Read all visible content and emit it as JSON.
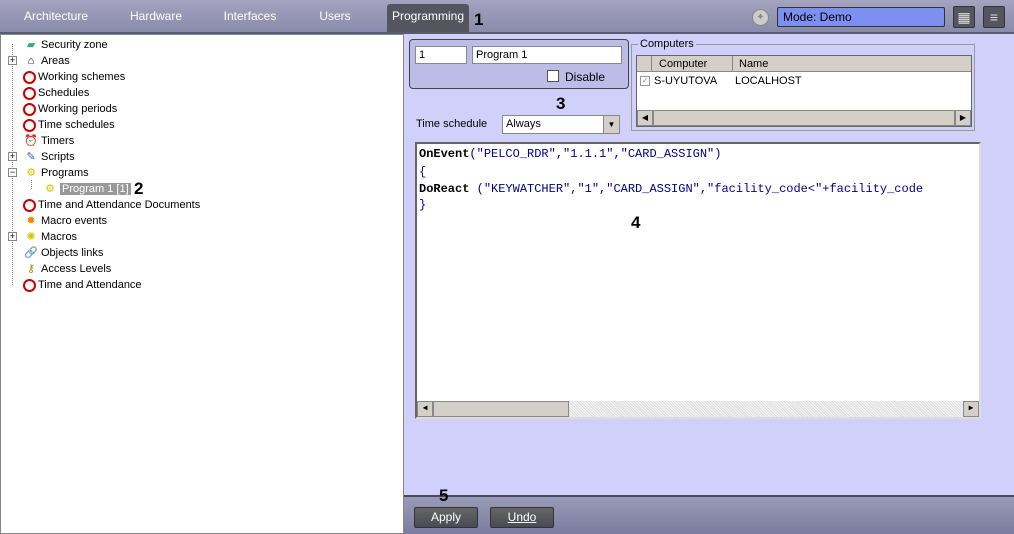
{
  "tabs": [
    "Architecture",
    "Hardware",
    "Interfaces",
    "Users",
    "Programming"
  ],
  "mode": "Mode: Demo",
  "annotations": [
    "1",
    "2",
    "3",
    "4",
    "5"
  ],
  "tree": [
    {
      "label": "Security zone",
      "icon": "security-zone-icon"
    },
    {
      "label": "Areas",
      "icon": "home-icon",
      "expander": "+"
    },
    {
      "label": "Working schemes",
      "icon": "clock-icon"
    },
    {
      "label": "Schedules",
      "icon": "clock-icon"
    },
    {
      "label": "Working periods",
      "icon": "clock-icon"
    },
    {
      "label": "Time schedules",
      "icon": "clock-icon"
    },
    {
      "label": "Timers",
      "icon": "alarm-clock-icon"
    },
    {
      "label": "Scripts",
      "icon": "script-icon",
      "expander": "+"
    },
    {
      "label": "Programs",
      "icon": "gears-icon",
      "expander": "−"
    },
    {
      "label": "Program 1 [1]",
      "icon": "gears-icon",
      "child": true,
      "selected": true
    },
    {
      "label": "Time and Attendance Documents",
      "icon": "clock-icon"
    },
    {
      "label": "Macro events",
      "icon": "macro-event-icon"
    },
    {
      "label": "Macros",
      "icon": "gear-icon",
      "expander": "+"
    },
    {
      "label": "Objects links",
      "icon": "link-icon"
    },
    {
      "label": "Access Levels",
      "icon": "keys-icon"
    },
    {
      "label": "Time and Attendance",
      "icon": "clock-icon"
    }
  ],
  "program": {
    "id": "1",
    "name": "Program 1",
    "disable_label": "Disable",
    "time_schedule_label": "Time schedule",
    "time_schedule_value": "Always"
  },
  "computers": {
    "legend": "Computers",
    "headers": [
      "Computer",
      "Name"
    ],
    "rows": [
      {
        "computer": "S-UYUTOVA",
        "name": "LOCALHOST",
        "checked": true
      }
    ]
  },
  "code": {
    "l1a": "OnEvent",
    "l1b": "(\"PELCO_RDR\",\"1.1.1\",\"CARD_ASSIGN\")",
    "l2": "{",
    "l3a": "DoReact",
    "l3b": " (\"KEYWATCHER\",\"1\",\"CARD_ASSIGN\",\"facility_code<\"+facility_code",
    "l4": "}"
  },
  "buttons": {
    "apply": "Apply",
    "undo": "Undo"
  }
}
